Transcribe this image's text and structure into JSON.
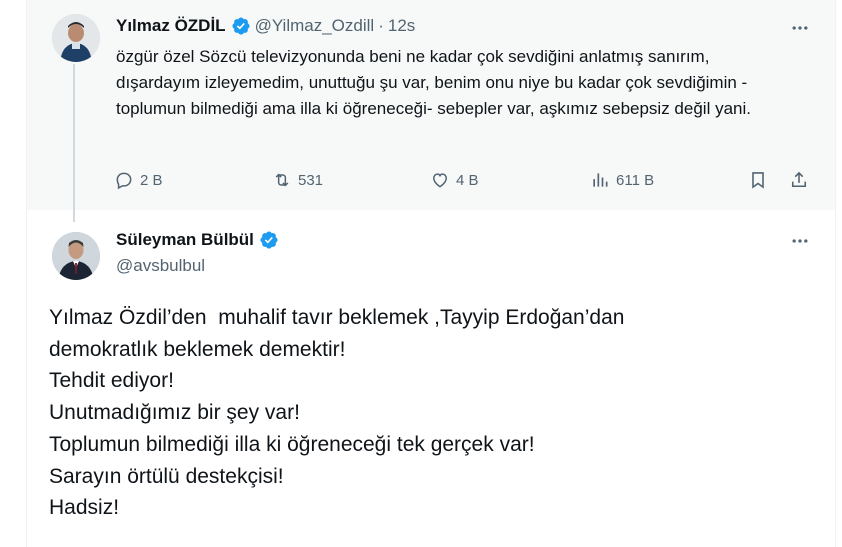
{
  "parent_tweet": {
    "author_name": "Yılmaz ÖZDİL",
    "handle": "@Yilmaz_Ozdill",
    "separator": "·",
    "time": "12s",
    "text": "özgür özel Sözcü televizyonunda beni ne kadar çok sevdiğini anlatmış sanırım, dışardayım izleyemedim, unuttuğu şu var, benim onu niye bu kadar çok sevdiğimin -toplumun bilmediği ama illa ki öğreneceği- sebepler var, aşkımız sebepsiz değil yani.",
    "replies": "2 B",
    "retweets": "531",
    "likes": "4 B",
    "views": "611 B"
  },
  "reply_tweet": {
    "author_name": "Süleyman Bülbül",
    "handle": "@avsbulbul",
    "lines": [
      "Yılmaz Özdil’den  muhalif tavır beklemek ,Tayyip Erdoğan’dan",
      "demokratlık beklemek demektir!",
      "Tehdit ediyor!",
      "Unutmadığımız bir şey var!",
      "Toplumun bilmediği illa ki öğreneceği tek gerçek var!",
      "Sarayın örtülü destekçisi!",
      "Hadsiz!"
    ]
  },
  "icons": {
    "verified": "verified-badge-icon",
    "more": "more-icon",
    "reply": "reply-icon",
    "retweet": "retweet-icon",
    "like": "heart-icon",
    "views": "views-icon",
    "bookmark": "bookmark-icon",
    "share": "share-icon"
  },
  "colors": {
    "verified_blue": "#1d9bf0",
    "text_primary": "#0f1419",
    "text_secondary": "#536471",
    "parent_background": "#f7f9f9",
    "thread_line": "#cfd9de"
  }
}
